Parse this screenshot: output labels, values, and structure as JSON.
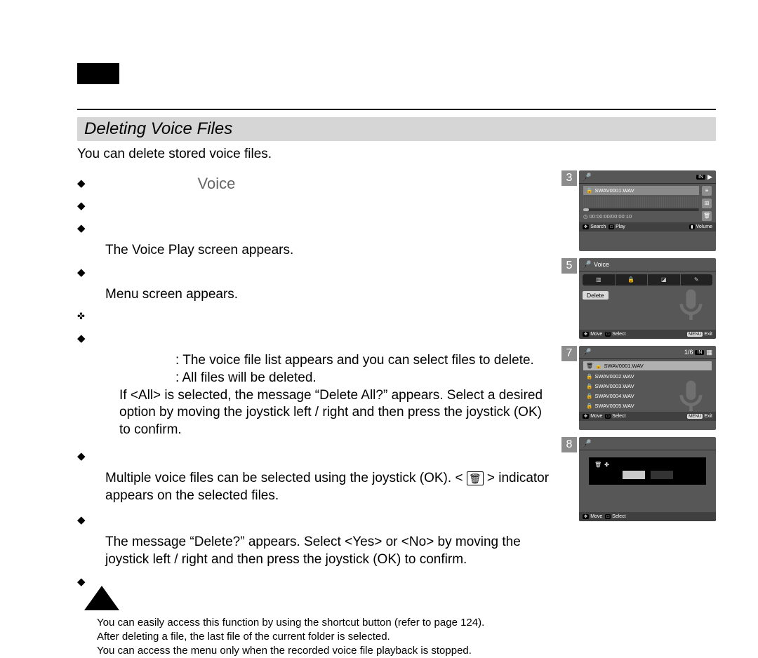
{
  "section_title": "Deleting Voice Files",
  "intro": "You can delete stored voice files.",
  "voice_word": "Voice",
  "lines": {
    "voice_play_appears": "The Voice Play screen appears.",
    "menu_screen_appears": "Menu screen appears.",
    "file_list_appears": ": The voice file list appears and you can select files to delete.",
    "all_deleted": ": All files will be deleted.",
    "delete_all_message": "If <All> is selected, the message “Delete All?” appears. Select a desired option by moving the joystick left / right and then press the joystick (OK) to confirm.",
    "multi_select_1": "Multiple voice files can be selected using the joystick (OK). < ",
    "multi_select_2": " > indicator appears on the selected files.",
    "delete_confirm": "The message “Delete?” appears. Select <Yes> or <No> by moving the joystick left / right and then press the joystick (OK) to confirm."
  },
  "notes": {
    "n1": "You can easily access this function by using the shortcut button (refer to page 124).",
    "n2": "After deleting a file, the last file of the current folder is selected.",
    "n3": "You can access the menu only when the recorded voice file playback is stopped."
  },
  "steps": {
    "s3": "3",
    "s5": "5",
    "s7": "7",
    "s8": "8"
  },
  "ui3": {
    "badge_in": "IN",
    "play": "▶",
    "filename": "SWAV0001.WAV",
    "timer": "00:00:00/00:00:10",
    "search": "Search",
    "play_hint": "Play",
    "volume": "Volume"
  },
  "ui5": {
    "title": "Voice",
    "delete": "Delete",
    "move": "Move",
    "select": "Select",
    "menu": "MENU",
    "exit": "Exit"
  },
  "ui7": {
    "count": "1/6",
    "in": "IN",
    "files": [
      "SWAV0001.WAV",
      "SWAV0002.WAV",
      "SWAV0003.WAV",
      "SWAV0004.WAV",
      "SWAV0005.WAV"
    ],
    "move": "Move",
    "select": "Select",
    "menu": "MENU",
    "exit": "Exit"
  },
  "ui8": {
    "move": "Move",
    "select": "Select"
  }
}
